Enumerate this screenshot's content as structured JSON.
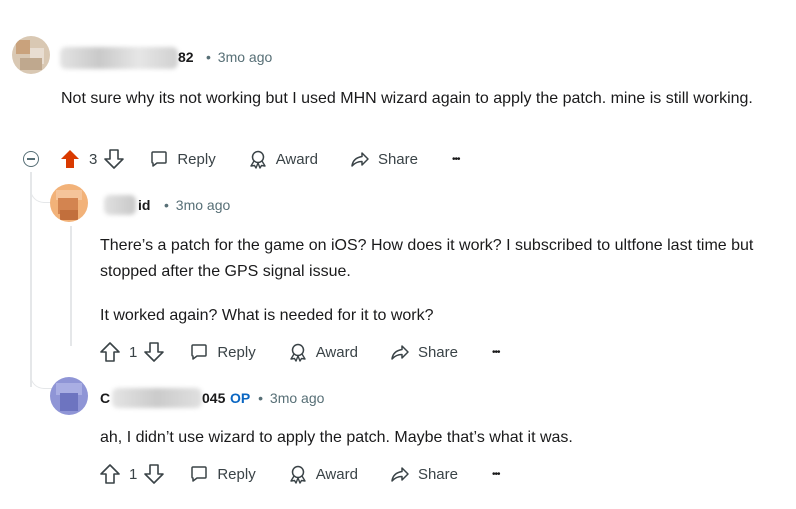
{
  "comments": [
    {
      "username_suffix": "82",
      "separator": "•",
      "time": "3mo ago",
      "body": "Not sure why its not working but I used MHN wizard again to apply the patch. mine is still working.",
      "votes": "3",
      "actions": {
        "reply": "Reply",
        "award": "Award",
        "share": "Share",
        "more": "•••"
      }
    },
    {
      "username_suffix": "id",
      "separator": "•",
      "time": "3mo ago",
      "body": [
        "There’s a patch for the game on iOS? How does it work? I subscribed to ultfone last time but stopped after the GPS signal issue.",
        "It worked again? What is needed for it to work?"
      ],
      "votes": "1",
      "actions": {
        "reply": "Reply",
        "award": "Award",
        "share": "Share",
        "more": "•••"
      }
    },
    {
      "username_prefix": "C",
      "username_suffix": "045",
      "op_badge": "OP",
      "separator": "•",
      "time": "3mo ago",
      "body": "ah, I didn’t use wizard to apply the patch. Maybe that’s what it was.",
      "votes": "1",
      "actions": {
        "reply": "Reply",
        "award": "Award",
        "share": "Share",
        "more": "•••"
      }
    }
  ],
  "colors": {
    "upvoted": "#d93a00",
    "op": "#0a66c2",
    "meta": "#576f76",
    "thread_line": "#e5e7e9"
  }
}
